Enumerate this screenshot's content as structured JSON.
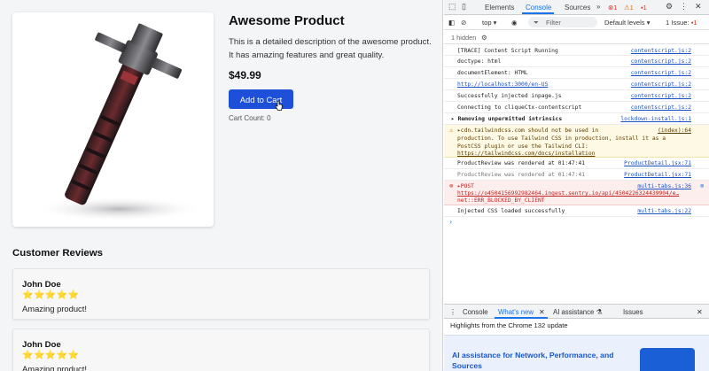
{
  "product": {
    "title": "Awesome Product",
    "description": "This is a detailed description of the awesome product. It has amazing features and great quality.",
    "price": "$49.99",
    "add_to_cart_label": "Add to Cart",
    "cart_count": "Cart Count: 0"
  },
  "reviews": {
    "heading": "Customer Reviews",
    "items": [
      {
        "name": "John Doe",
        "stars": "⭐⭐⭐⭐⭐",
        "rating": 5,
        "text": "Amazing product!"
      },
      {
        "name": "John Doe",
        "stars": "⭐⭐⭐⭐⭐",
        "rating": 5,
        "text": "Amazing product!"
      }
    ]
  },
  "devtools": {
    "tabs": [
      "Elements",
      "Console",
      "Sources"
    ],
    "active_tab": "Console",
    "more_tabs": "»",
    "errors_count": "1",
    "warnings_count": "1",
    "info_count": "1",
    "context": "top",
    "filter_placeholder": "Filter",
    "levels": "Default levels",
    "issues": "1 Issue:",
    "issues_count": "1",
    "hidden": "1 hidden",
    "logs": [
      {
        "msg": "[TRACE] Content Script Running",
        "src": "contentscript.js:2"
      },
      {
        "msg": "doctype: html",
        "src": "contentscript.js:2"
      },
      {
        "msg": "documentElement: HTML",
        "src": "contentscript.js:2"
      },
      {
        "msg": "http://localhost:3000/en-US",
        "src": "contentscript.js:2"
      },
      {
        "msg": "Successfully injected inpage.js",
        "src": "contentscript.js:2"
      },
      {
        "msg": "Connecting to cliqueCtx-contentscript",
        "src": "contentscript.js:2"
      },
      {
        "msg": "▸ Removing unpermitted intrinsics",
        "src": "lockdown-install.js:1"
      },
      {
        "line1": "▸cdn.tailwindcss.com should not be used in",
        "line2": "production. To use Tailwind CSS in production, install it as a",
        "line3": "PostCSS plugin or use the Tailwind CLI:",
        "link": "https://tailwindcss.com/docs/installation",
        "src": "(index):64"
      },
      {
        "msg": "ProductReview was rendered at 01:47:41",
        "src": "ProductDetail.jsx:71"
      },
      {
        "msg": "ProductReview was rendered at 01:47:41",
        "src": "ProductDetail.jsx:71"
      },
      {
        "line1": "▸POST",
        "link": "https://o4504156992982464.ingest.sentry.io/api/4504226324439904/e…",
        "line3": "net::ERR_BLOCKED_BY_CLIENT",
        "src": "multi-tabs.js:36"
      },
      {
        "msg": "Injected CSS loaded successfully",
        "src": "multi-tabs.js:22"
      }
    ],
    "prompt": "›",
    "drawer_tabs": [
      "Console",
      "What's new",
      "AI assistance",
      "Issues"
    ],
    "drawer_active": "What's new",
    "highlights": "Highlights from the Chrome 132 update",
    "banner_title": "AI assistance for Network, Performance, and Sources"
  }
}
